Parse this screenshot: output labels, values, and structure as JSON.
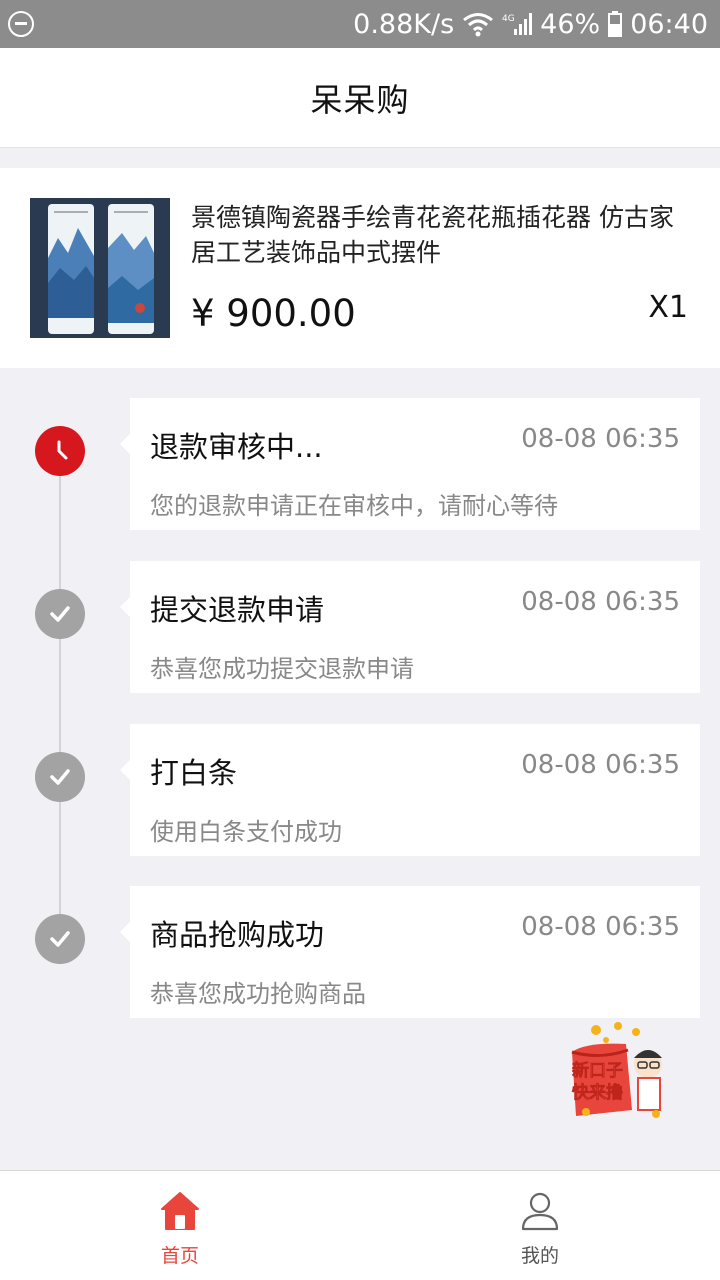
{
  "status_bar": {
    "speed": "0.88K/s",
    "network": "4G",
    "battery": "46%",
    "time": "06:40"
  },
  "header": {
    "title": "呆呆购"
  },
  "product": {
    "name": "景德镇陶瓷器手绘青花瓷花瓶插花器 仿古家居工艺装饰品中式摆件",
    "price": "¥ 900.00",
    "quantity": "X1"
  },
  "timeline": [
    {
      "title": "退款审核中...",
      "time": "08-08 06:35",
      "desc": "您的退款申请正在审核中，请耐心等待",
      "status": "active"
    },
    {
      "title": "提交退款申请",
      "time": "08-08 06:35",
      "desc": "恭喜您成功提交退款申请",
      "status": "done"
    },
    {
      "title": "打白条",
      "time": "08-08 06:35",
      "desc": "使用白条支付成功",
      "status": "done"
    },
    {
      "title": "商品抢购成功",
      "time": "08-08 06:35",
      "desc": "恭喜您成功抢购商品",
      "status": "done"
    }
  ],
  "promo": {
    "text_line1": "新口子",
    "text_line2": "快来撸"
  },
  "bottom_nav": {
    "home_label": "首页",
    "mine_label": "我的"
  },
  "colors": {
    "accent": "#e8453c",
    "active_node": "#d6171e",
    "done_node": "#a3a3a3"
  }
}
